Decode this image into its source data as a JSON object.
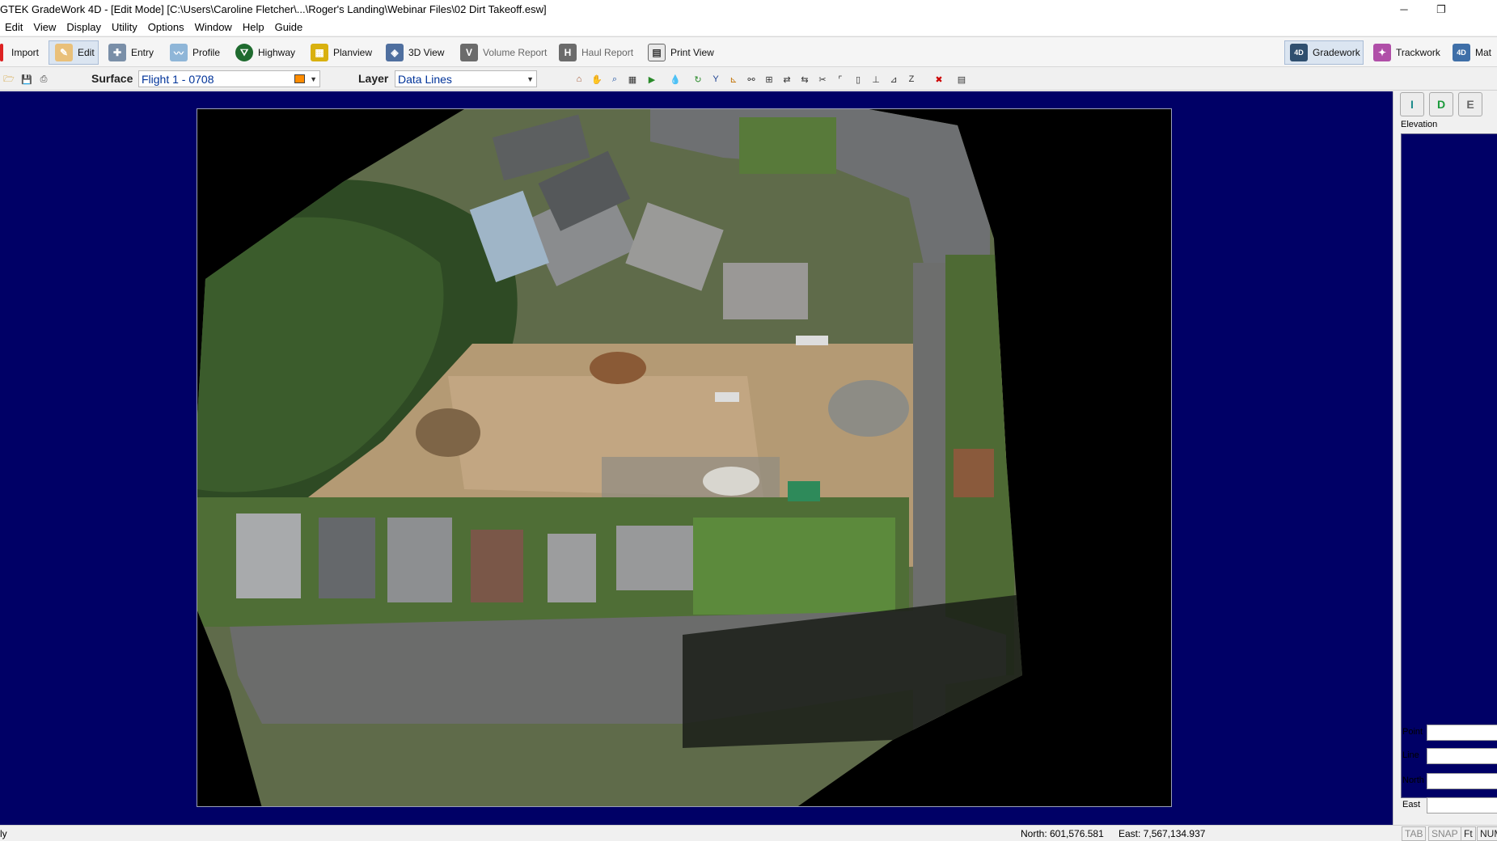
{
  "window": {
    "title": "GTEK GradeWork 4D - [Edit Mode]  [C:\\Users\\Caroline Fletcher\\...\\Roger's Landing\\Webinar Files\\02 Dirt Takeoff.esw]",
    "minimize_glyph": "─",
    "restore_glyph": "❐",
    "close_glyph": ""
  },
  "menu": [
    "Edit",
    "View",
    "Display",
    "Utility",
    "Options",
    "Window",
    "Help",
    "Guide"
  ],
  "toolbar": {
    "left_buttons": [
      {
        "label": "Import",
        "icon": "import-icon"
      },
      {
        "label": "Edit",
        "icon": "edit-pencil-icon",
        "active": true
      },
      {
        "label": "Entry",
        "icon": "entry-icon"
      },
      {
        "label": "Profile",
        "icon": "profile-icon"
      },
      {
        "label": "Highway",
        "icon": "highway-icon"
      },
      {
        "label": "Planview",
        "icon": "planview-icon"
      },
      {
        "label": "3D View",
        "icon": "3d-view-icon"
      },
      {
        "label": "Volume Report",
        "icon": "volume-report-icon",
        "disabled": true
      },
      {
        "label": "Haul Report",
        "icon": "haul-report-icon",
        "disabled": true
      },
      {
        "label": "Print View",
        "icon": "print-view-icon"
      }
    ],
    "right_buttons": [
      {
        "label": "Gradework",
        "icon": "gradework-icon",
        "active": true
      },
      {
        "label": "Trackwork",
        "icon": "trackwork-icon"
      },
      {
        "label": "Mat",
        "icon": "mat-icon"
      }
    ]
  },
  "toolbar2": {
    "surface_label": "Surface",
    "surface_value": "Flight 1 - 0708",
    "surface_color": "#ff8c00",
    "layer_label": "Layer",
    "layer_value": "Data Lines"
  },
  "right_panel": {
    "buttons": [
      "I",
      "D",
      "E"
    ],
    "elevation_label": "Elevation",
    "fields": [
      "Point",
      "Line",
      "North",
      "East"
    ]
  },
  "status": {
    "left_text": "ly",
    "north": "North: 601,576.581",
    "east": "East: 7,567,134.937",
    "indicators": [
      "TAB",
      "SNAP",
      "Ft",
      "NUM"
    ]
  },
  "colors": {
    "workspace_bg": "#000066",
    "accent": "#dbe5f1"
  }
}
